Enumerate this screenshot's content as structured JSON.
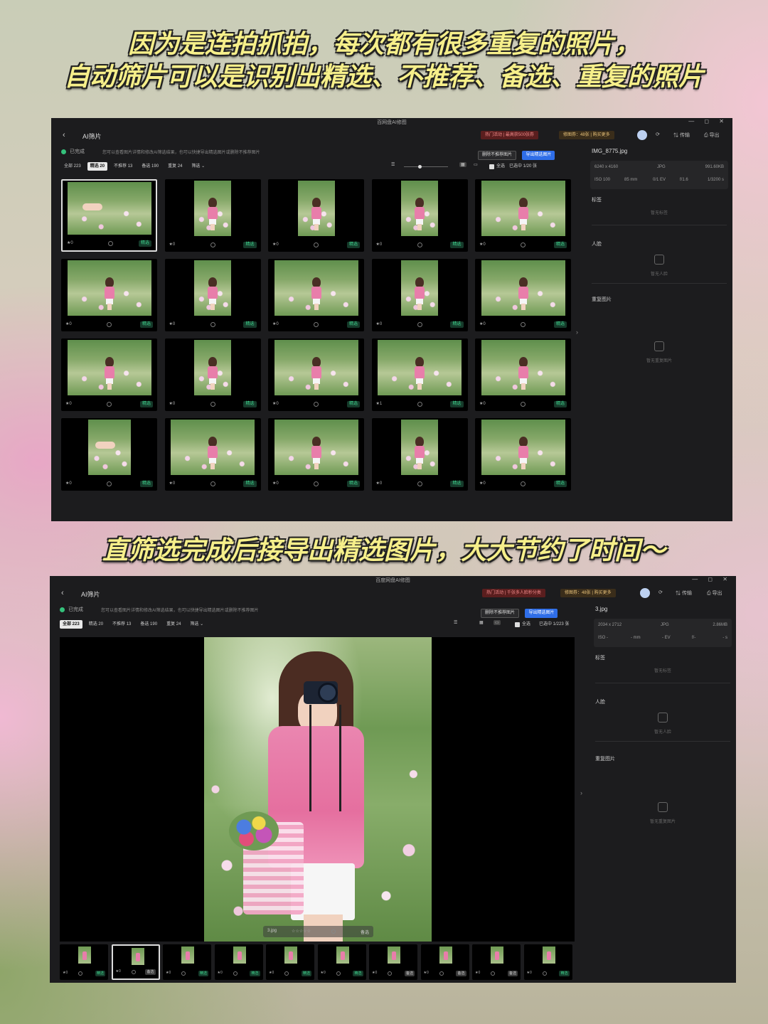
{
  "captions": {
    "line1": "因为是连拍抓拍，每次都有很多重复的照片，",
    "line2": "自动筛片可以是识别出精选、不推荐、备选、重复的照片",
    "line3": "直筛选完成后接导出精选图片，大大节约了时间～"
  },
  "common": {
    "app_title": "AI筛片",
    "status": "已完成",
    "hint": "您可以查看图片详情和修改AI筛选结果，也可以快捷导出精选图片或删除不推荐图片",
    "delete_btn": "删除不推荐图片",
    "export_btn": "导出精选图片",
    "quota": "修图券：48张 | 购买更多",
    "transfer": "⇅ 传输",
    "export_top": "⎙ 导出",
    "window_controls": "— ◻ ✕",
    "back": "‹",
    "select_all": "全选",
    "filter_more": "筛选 ⌄",
    "sort_icon": "☰",
    "grid_icon": "▦",
    "single_icon": "▭",
    "side_arrow": "›",
    "section_tags": "标签",
    "empty_tags": "暂无标签",
    "section_faces": "人脸",
    "empty_faces": "暂无人脸",
    "section_dup": "重复图片",
    "empty_dup": "暂无重复图片"
  },
  "win1": {
    "window_title": "百网盘AI修图",
    "promo": "热门活动 | 最高获500张券",
    "filters": [
      "全部 223",
      "精选 20",
      "不推荐 13",
      "备选 190",
      "重复 24"
    ],
    "active_filter": 1,
    "selection": "已选中 1/20 张",
    "file_name": "IMG_8775.jpg",
    "meta": {
      "resolution": "6240 x 4160",
      "format": "JPG",
      "size": "991.60KB",
      "iso": "ISO 100",
      "focal": "85 mm",
      "ev": "0/1 EV",
      "aperture": "f/1.6",
      "shutter": "1/3200 s"
    },
    "grid": [
      {
        "star": "★0",
        "tag": "精选",
        "shape": "land",
        "hand": true,
        "selected": true
      },
      {
        "star": "★0",
        "tag": "精选",
        "shape": "port"
      },
      {
        "star": "★0",
        "tag": "精选",
        "shape": "port"
      },
      {
        "star": "★0",
        "tag": "精选",
        "shape": "port"
      },
      {
        "star": "★0",
        "tag": "精选",
        "shape": "land"
      },
      {
        "star": "★0",
        "tag": "精选",
        "shape": "land"
      },
      {
        "star": "★0",
        "tag": "精选",
        "shape": "port"
      },
      {
        "star": "★0",
        "tag": "精选",
        "shape": "land"
      },
      {
        "star": "★0",
        "tag": "精选",
        "shape": "port"
      },
      {
        "star": "★0",
        "tag": "精选",
        "shape": "land"
      },
      {
        "star": "★0",
        "tag": "精选",
        "shape": "land"
      },
      {
        "star": "★0",
        "tag": "精选",
        "shape": "port"
      },
      {
        "star": "★0",
        "tag": "精选",
        "shape": "land"
      },
      {
        "star": "★1",
        "tag": "精选",
        "shape": "land"
      },
      {
        "star": "★0",
        "tag": "精选",
        "shape": "land"
      },
      {
        "star": "★0",
        "tag": "精选",
        "shape": "sq",
        "hand": true
      },
      {
        "star": "★0",
        "tag": "精选",
        "shape": "land"
      },
      {
        "star": "★0",
        "tag": "精选",
        "shape": "land"
      },
      {
        "star": "★0",
        "tag": "精选",
        "shape": "port"
      },
      {
        "star": "★0",
        "tag": "精选",
        "shape": "land"
      }
    ]
  },
  "win2": {
    "window_title": "百度网盘AI修图",
    "promo": "热门活动 | 千张多人脸秒分类",
    "filters": [
      "全部 223",
      "精选 20",
      "不推荐 13",
      "备选 190",
      "重复 24"
    ],
    "active_filter": 0,
    "selection": "已选中 1/223 张",
    "file_name": "3.jpg",
    "meta": {
      "resolution": "2034 x 2712",
      "format": "JPG",
      "size": "2.86MB",
      "iso": "ISO -",
      "focal": "- mm",
      "ev": "- EV",
      "aperture": "f/-",
      "shutter": "- s"
    },
    "overlay": {
      "name": "3.jpg",
      "stars": "☆☆☆☆☆",
      "tag": "备选"
    },
    "strip": [
      {
        "star": "★0",
        "tag": "精选"
      },
      {
        "star": "★0",
        "tag": "备选",
        "selected": true
      },
      {
        "star": "★0",
        "tag": "精选"
      },
      {
        "star": "★0",
        "tag": "精选"
      },
      {
        "star": "★0",
        "tag": "精选"
      },
      {
        "star": "★0",
        "tag": "精选"
      },
      {
        "star": "★0",
        "tag": "备选"
      },
      {
        "star": "★0",
        "tag": "备选"
      },
      {
        "star": "★0",
        "tag": "备选"
      },
      {
        "star": "★0",
        "tag": "精选"
      }
    ]
  }
}
